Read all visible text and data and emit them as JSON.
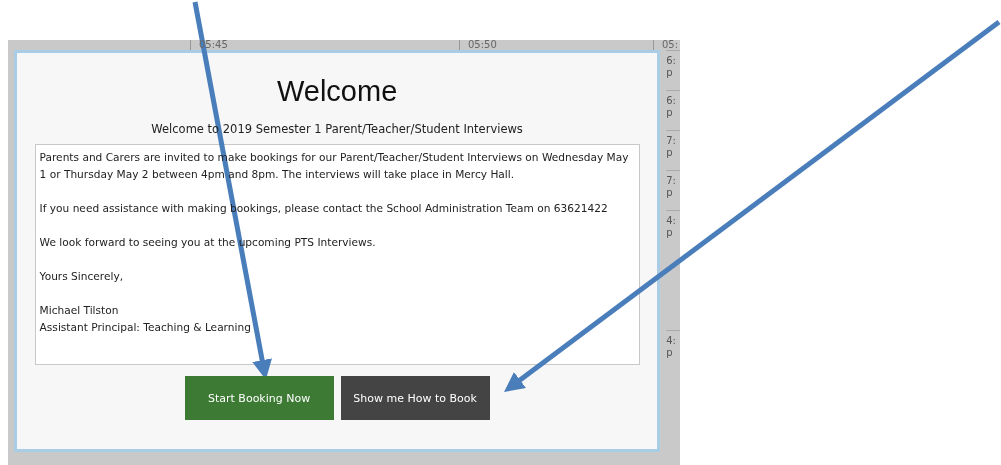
{
  "schedule": {
    "header_times": [
      "05:45",
      "05:50",
      "05:"
    ],
    "side_cells": [
      {
        "time": "6:",
        "note": "p"
      },
      {
        "time": "6:",
        "note": "p"
      },
      {
        "time": "7:",
        "note": "p"
      },
      {
        "time": "7:",
        "note": "p"
      },
      {
        "time": "4:",
        "note": "p"
      },
      {
        "time": "4:",
        "note": "p"
      }
    ]
  },
  "modal": {
    "title": "Welcome",
    "subtitle": "Welcome to 2019 Semester 1 Parent/Teacher/Student Interviews",
    "message": [
      "Parents and Carers are invited to make bookings for our Parent/Teacher/Student Interviews on Wednesday May 1 or Thursday May 2 between 4pm and 8pm.  The interviews will take place in Mercy Hall.",
      "If you need assistance with making bookings, please contact the School Administration Team on 63621422",
      "We look forward to seeing you at the upcoming PTS Interviews.",
      "Yours Sincerely,",
      "Michael Tilston\nAssistant Principal: Teaching & Learning"
    ],
    "buttons": [
      {
        "label": "Start Booking Now",
        "kind": "primary"
      },
      {
        "label": "Show me How to Book",
        "kind": "secondary"
      }
    ]
  }
}
